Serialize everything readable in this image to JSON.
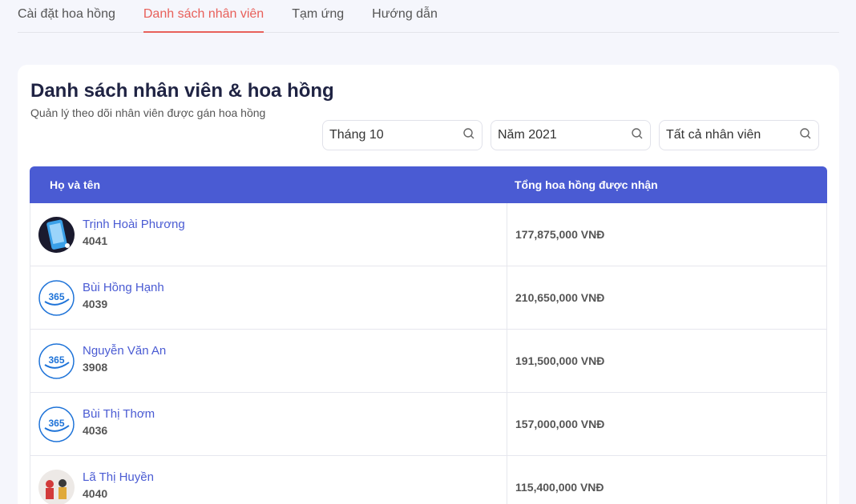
{
  "tabs": [
    {
      "label": "Cài đặt hoa hồng"
    },
    {
      "label": "Danh sách nhân viên"
    },
    {
      "label": "Tạm ứng"
    },
    {
      "label": "Hướng dẫn"
    }
  ],
  "card": {
    "title": "Danh sách nhân viên & hoa hồng",
    "subtitle": "Quản lý theo dõi nhân viên được gán hoa hồng"
  },
  "filters": {
    "month": "Tháng 10",
    "year": "Năm 2021",
    "employee": "Tất cả nhân viên"
  },
  "table": {
    "headers": [
      "Họ và tên",
      "Tổng hoa hồng được nhận"
    ],
    "rows": [
      {
        "name": "Trịnh Hoài Phương",
        "id": "4041",
        "amount": "177,875,000 VNĐ",
        "avatar": "phone-photo"
      },
      {
        "name": "Bùi Hồng Hạnh",
        "id": "4039",
        "amount": "210,650,000 VNĐ",
        "avatar": "365-logo"
      },
      {
        "name": "Nguyễn Văn An",
        "id": "3908",
        "amount": "191,500,000 VNĐ",
        "avatar": "365-logo"
      },
      {
        "name": "Bùi Thị Thơm",
        "id": "4036",
        "amount": "157,000,000 VNĐ",
        "avatar": "365-logo"
      },
      {
        "name": "Lã Thị Huyền",
        "id": "4040",
        "amount": "115,400,000 VNĐ",
        "avatar": "people-photo"
      }
    ]
  },
  "colors": {
    "accent": "#4a5bd3",
    "active_tab": "#e8605a"
  }
}
